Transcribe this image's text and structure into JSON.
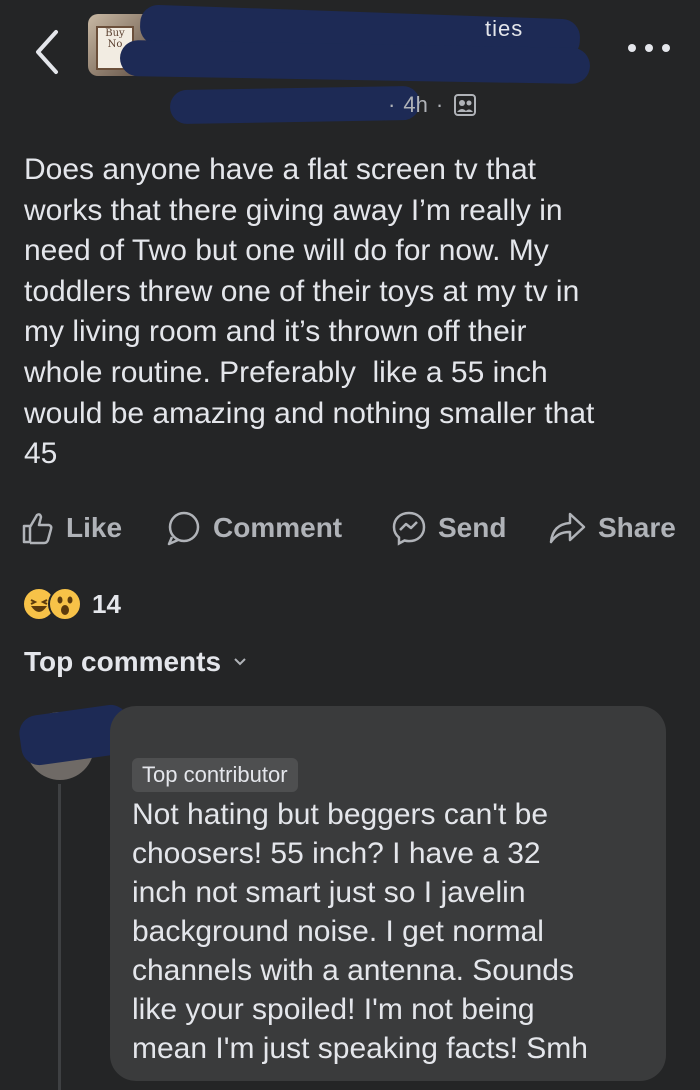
{
  "header": {
    "group_title_fragment": "ties",
    "timestamp": "4h",
    "back_icon": "chevron-left-icon",
    "more_icon": "ellipsis-icon",
    "audience_icon": "group-privacy-icon"
  },
  "group_avatar": {
    "sign_text": "Buy\nNo"
  },
  "post": {
    "text": "Does anyone have a flat screen tv that\nworks that there giving away I’m really in\nneed of Two but one will do for now. My\ntoddlers threw one of their toys at my tv in\nmy living room and it’s thrown off their\nwhole routine. Preferably  like a 55 inch\nwould be amazing and nothing smaller that\n45"
  },
  "actions": {
    "like": "Like",
    "comment": "Comment",
    "send": "Send",
    "share": "Share"
  },
  "reactions": {
    "count": "14",
    "types": [
      "haha-icon",
      "wow-icon"
    ]
  },
  "comments_section": {
    "filter_label": "Top comments"
  },
  "comment": {
    "badge": "Top contributor",
    "text": "Not hating but beggers can't be\nchoosers! 55 inch? I have a 32\ninch not smart just so I javelin\nbackground noise. I get normal\nchannels with a antenna. Sounds\nlike your spoiled! I'm not being\nmean I'm just speaking facts! Smh"
  },
  "colors": {
    "background": "#242526",
    "bubble": "#3a3b3c",
    "text": "#e4e6eb",
    "secondary_text": "#b0b3b8",
    "redaction": "#1d2a55"
  }
}
